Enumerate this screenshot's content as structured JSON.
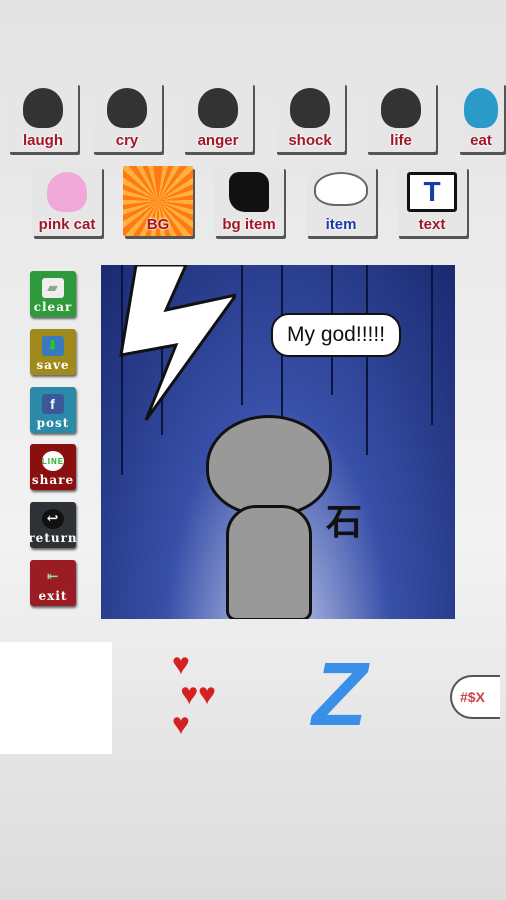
{
  "categories_row1": [
    {
      "label": "laugh"
    },
    {
      "label": "cry"
    },
    {
      "label": "anger"
    },
    {
      "label": "shock"
    },
    {
      "label": "life"
    },
    {
      "label": "eat"
    }
  ],
  "categories_row2": [
    {
      "label": "pink cat"
    },
    {
      "label": "BG"
    },
    {
      "label": "bg item"
    },
    {
      "label": "item"
    },
    {
      "label": "text"
    }
  ],
  "tools": [
    {
      "label": "clear",
      "color": "#2e9a3c"
    },
    {
      "label": "save",
      "color": "#a08a1c"
    },
    {
      "label": "post",
      "color": "#2a8aa8"
    },
    {
      "label": "share",
      "color": "#8a1010"
    },
    {
      "label": "return",
      "color": "#2e3236"
    },
    {
      "label": "exit",
      "color": "#9a1c24"
    }
  ],
  "canvas": {
    "speech_text": "My god!!!!!",
    "kanji": "石"
  },
  "item_strip": {
    "bubble_text": "#$%@*",
    "z_letter": "Z",
    "bubble_text_item": "#$X"
  },
  "colors": {
    "label_red": "#a01828",
    "item_blue": "#1a3aaa",
    "canvas_blue": "#3850a8"
  }
}
